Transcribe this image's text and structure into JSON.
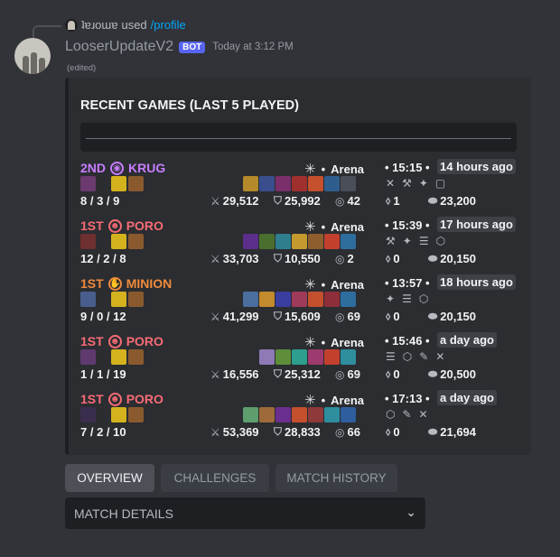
{
  "reply": {
    "user": "ʇɐɹoɯɐ",
    "used": "used",
    "command": "/profile"
  },
  "message": {
    "username": "LooserUpdateV2",
    "bot_tag": "BOT",
    "timestamp": "Today at 3:12 PM",
    "edited": "(edited)"
  },
  "embed": {
    "title": "RECENT GAMES (LAST 5 PLAYED)",
    "games": [
      {
        "place": "2ND",
        "place_color": "#c77dff",
        "team": "KRUG",
        "team_icon": "krug-icon",
        "mode": "Arena",
        "duration": "15:15",
        "ago": "14 hours ago",
        "kda": "8 / 3 / 9",
        "damage": "29,512",
        "mitigated": "25,992",
        "gold_other": "42",
        "augment_count": "1",
        "gold": "23,200",
        "champion_color": "#6b3a6e",
        "item_colors": [
          "#b58a2a",
          "#3a4e8e",
          "#7a2e6a",
          "#a0302e",
          "#c4502e",
          "#2e5e8e",
          "#4a4e58"
        ],
        "augment_icons": [
          "augment-icon",
          "augment-icon",
          "augment-icon",
          "empty-slot"
        ]
      },
      {
        "place": "1ST",
        "place_color": "#f76b74",
        "team": "PORO",
        "team_icon": "poro-icon",
        "mode": "Arena",
        "duration": "15:39",
        "ago": "17 hours ago",
        "kda": "12 / 2 / 8",
        "damage": "33,703",
        "mitigated": "10,550",
        "gold_other": "2",
        "augment_count": "0",
        "gold": "20,150",
        "champion_color": "#6e3030",
        "item_colors": [
          "#5a2e8a",
          "#4a6e2e",
          "#2e7e8e",
          "#c49a2e",
          "#8e5e2e",
          "#c4402e",
          "#2e6e9e"
        ],
        "augment_icons": [
          "augment-icon",
          "augment-icon",
          "augment-icon",
          "augment-icon"
        ]
      },
      {
        "place": "1ST",
        "place_color": "#f08a3c",
        "team": "MINION",
        "team_icon": "minion-icon",
        "mode": "Arena",
        "duration": "13:57",
        "ago": "18 hours ago",
        "kda": "9 / 0 / 12",
        "damage": "41,299",
        "mitigated": "15,609",
        "gold_other": "69",
        "augment_count": "0",
        "gold": "20,150",
        "champion_color": "#4a5e8e",
        "item_colors": [
          "#4a6e9e",
          "#c48a2e",
          "#3a3e9e",
          "#9e3a5a",
          "#c4502e",
          "#8e2e3a",
          "#2e6e9e"
        ],
        "augment_icons": [
          "augment-icon",
          "augment-icon",
          "augment-icon"
        ]
      },
      {
        "place": "1ST",
        "place_color": "#f76b74",
        "team": "PORO",
        "team_icon": "poro-icon",
        "mode": "Arena",
        "duration": "15:46",
        "ago": "a day ago",
        "kda": "1 / 1 / 19",
        "damage": "16,556",
        "mitigated": "25,312",
        "gold_other": "69",
        "augment_count": "0",
        "gold": "20,500",
        "champion_color": "#5e3a6e",
        "item_colors": [
          "#8e7ab4",
          "#5e8e3a",
          "#2e9e8e",
          "#9e3a6e",
          "#c4402e",
          "#2e8e9e"
        ],
        "augment_icons": [
          "augment-icon",
          "augment-icon",
          "augment-icon",
          "augment-icon"
        ]
      },
      {
        "place": "1ST",
        "place_color": "#f76b74",
        "team": "PORO",
        "team_icon": "poro-icon",
        "mode": "Arena",
        "duration": "17:13",
        "ago": "a day ago",
        "kda": "7 / 2 / 10",
        "damage": "53,369",
        "mitigated": "28,833",
        "gold_other": "66",
        "augment_count": "0",
        "gold": "21,694",
        "champion_color": "#3a2e4e",
        "item_colors": [
          "#5e9e6e",
          "#9e6a3a",
          "#6a2e8e",
          "#c4502e",
          "#8e3a3a",
          "#2e8e9e",
          "#2e5e9e"
        ],
        "augment_icons": [
          "augment-icon",
          "augment-icon",
          "augment-icon"
        ]
      }
    ]
  },
  "buttons": [
    {
      "label": "OVERVIEW",
      "style": "primary"
    },
    {
      "label": "CHALLENGES",
      "style": "secondary"
    },
    {
      "label": "MATCH HISTORY",
      "style": "secondary"
    }
  ],
  "select": {
    "placeholder": "MATCH DETAILS"
  },
  "colors": {
    "blurple": "#5865f2",
    "link": "#00a8fc",
    "background": "#313338",
    "embed_bg": "#2b2d31"
  }
}
